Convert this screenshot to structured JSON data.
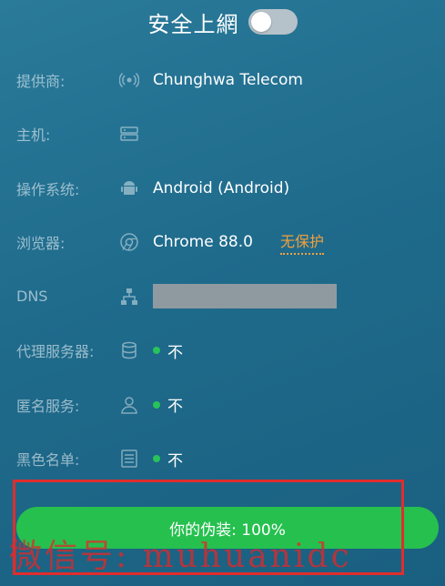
{
  "header": {
    "title": "安全上網",
    "toggle_on": false
  },
  "rows": [
    {
      "label": "提供商:",
      "icon": "antenna-icon",
      "value": "Chunghwa Telecom"
    },
    {
      "label": "主机:",
      "icon": "server-icon",
      "value": ""
    },
    {
      "label": "操作系统:",
      "icon": "android-icon",
      "value": "Android (Android)"
    },
    {
      "label": "浏览器:",
      "icon": "chrome-icon",
      "value": "Chrome 88.0",
      "warning": "无保护"
    },
    {
      "label": "DNS",
      "icon": "network-icon",
      "value_redacted": true
    },
    {
      "label": "代理服务器:",
      "icon": "database-icon",
      "status": "不",
      "status_color": "#28c35a"
    },
    {
      "label": "匿名服务:",
      "icon": "user-icon",
      "status": "不",
      "status_color": "#28c35a"
    },
    {
      "label": "黑色名单:",
      "icon": "list-icon",
      "status": "不",
      "status_color": "#28c35a"
    }
  ],
  "disguise": {
    "label": "你的伪装: 100%",
    "percent": 100,
    "color": "#26c04f"
  },
  "watermark": "微信号: muhuanidc",
  "colors": {
    "background": "#1f6b8c",
    "accent_warning": "#f0a13c",
    "highlight_border": "#e02d2d"
  }
}
